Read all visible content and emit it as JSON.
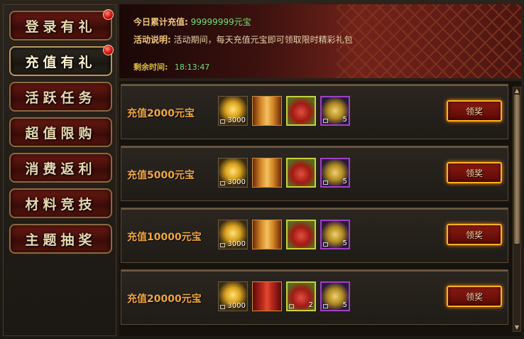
{
  "nav": {
    "items": [
      {
        "label": "登录有礼",
        "active": false,
        "badge": true
      },
      {
        "label": "充值有礼",
        "active": true,
        "badge": true
      },
      {
        "label": "活跃任务",
        "active": false,
        "badge": false
      },
      {
        "label": "超值限购",
        "active": false,
        "badge": false
      },
      {
        "label": "消费返利",
        "active": false,
        "badge": false
      },
      {
        "label": "材料竞技",
        "active": false,
        "badge": false
      },
      {
        "label": "主题抽奖",
        "active": false,
        "badge": false
      }
    ]
  },
  "banner": {
    "total_label": "今日累计充值:",
    "total_value": "99999999元宝",
    "desc_label": "活动说明:",
    "desc_text": "活动期间，每天充值元宝即可领取限时精彩礼包",
    "timer_label": "剩余时间:",
    "timer_value": "18:13:47"
  },
  "rewards": [
    {
      "label": "充值2000元宝",
      "claim": "领奖",
      "items": [
        {
          "icon": "gold-ingot-icon",
          "count": "3000"
        },
        {
          "icon": "scroll-icon",
          "count": ""
        },
        {
          "icon": "red-bag-icon",
          "count": ""
        },
        {
          "icon": "token-icon",
          "count": "5"
        }
      ]
    },
    {
      "label": "充值5000元宝",
      "claim": "领奖",
      "items": [
        {
          "icon": "gold-ingot-icon",
          "count": "3000"
        },
        {
          "icon": "scroll-icon",
          "count": ""
        },
        {
          "icon": "red-bag-icon",
          "count": ""
        },
        {
          "icon": "token-icon",
          "count": "5"
        }
      ]
    },
    {
      "label": "充值10000元宝",
      "claim": "领奖",
      "items": [
        {
          "icon": "gold-ingot-icon",
          "count": "3000"
        },
        {
          "icon": "scroll-icon",
          "count": ""
        },
        {
          "icon": "red-bag-icon",
          "count": ""
        },
        {
          "icon": "token-icon",
          "count": "5"
        }
      ]
    },
    {
      "label": "充值20000元宝",
      "claim": "领奖",
      "items": [
        {
          "icon": "gold-ingot-icon",
          "count": "3000"
        },
        {
          "icon": "red-book-icon",
          "count": ""
        },
        {
          "icon": "red-bag-icon",
          "count": "2"
        },
        {
          "icon": "token-icon",
          "count": "5"
        }
      ]
    }
  ],
  "colors": {
    "accent": "#f0a640",
    "timer": "#6fe06f",
    "claim_border": "#ffb020"
  }
}
